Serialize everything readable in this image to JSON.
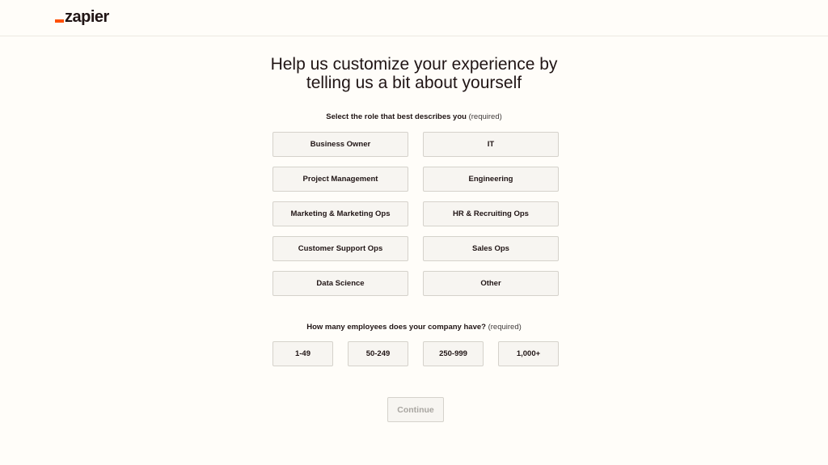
{
  "brand": {
    "name": "zapier",
    "accent": "#ff4f00"
  },
  "headline": {
    "line1": "Help us customize your experience by",
    "line2": "telling us a bit about yourself"
  },
  "role_question": {
    "label": "Select the role that best describes you",
    "required": "(required)"
  },
  "roles": [
    "Business Owner",
    "IT",
    "Project Management",
    "Engineering",
    "Marketing & Marketing Ops",
    "HR & Recruiting Ops",
    "Customer Support Ops",
    "Sales Ops",
    "Data Science",
    "Other"
  ],
  "size_question": {
    "label": "How many employees does your company have?",
    "required": "(required)"
  },
  "sizes": [
    "1-49",
    "50-249",
    "250-999",
    "1,000+"
  ],
  "continue_label": "Continue"
}
